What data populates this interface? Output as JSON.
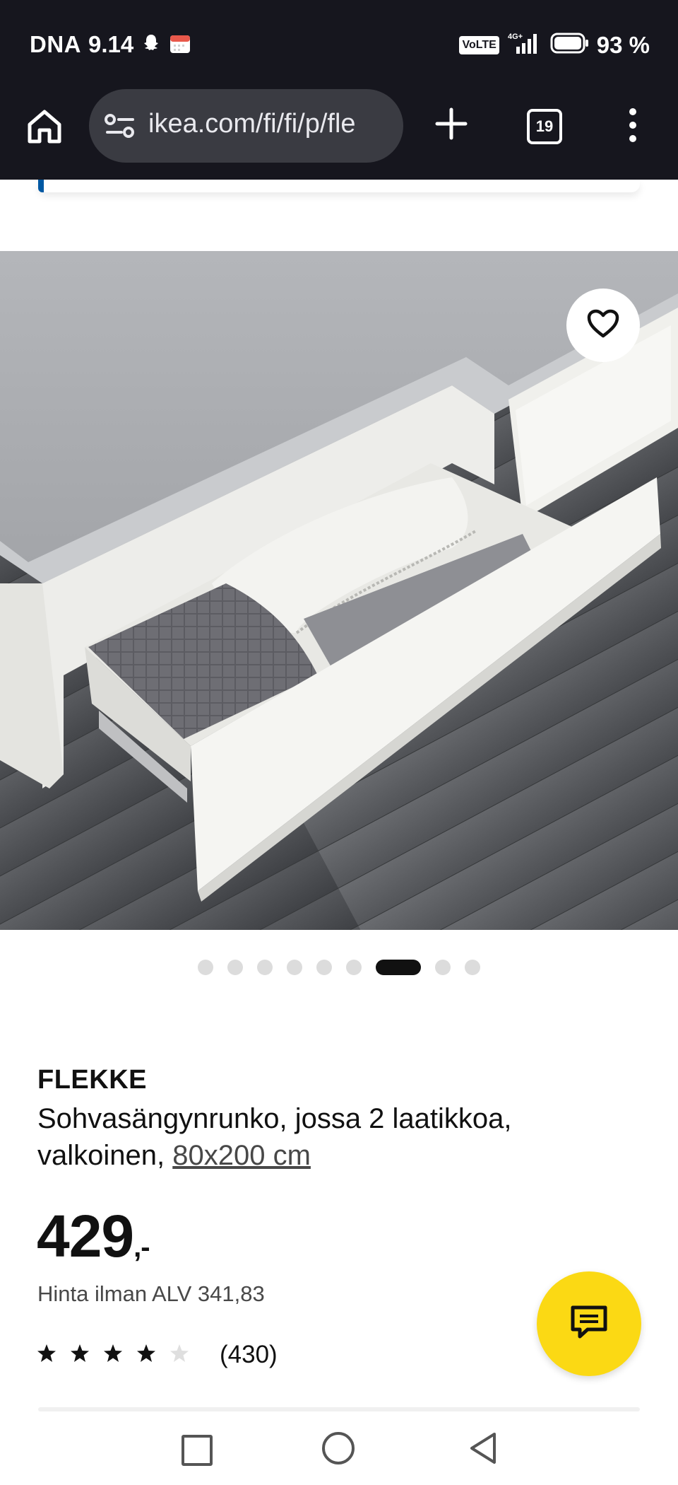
{
  "status_bar": {
    "carrier": "DNA",
    "time": "9.14",
    "network_badge": "VoLTE",
    "network_type": "4G+",
    "battery": "93 %",
    "icons": [
      "snapchat-icon",
      "calendar-icon",
      "signal-icon",
      "battery-icon"
    ]
  },
  "browser": {
    "url": "ikea.com/fi/fi/p/fle",
    "tab_count": "19",
    "icons": [
      "home-icon",
      "site-settings-icon",
      "plus-icon",
      "tabs-icon",
      "more-menu-icon"
    ]
  },
  "gallery": {
    "image_alt": "FLEKKE bed frame with open drawer",
    "dot_count": 9,
    "active_dot_index": 6,
    "favorite_icon": "heart-icon"
  },
  "product": {
    "name": "FLEKKE",
    "description": "Sohvasängynrunko, jossa 2 laatikkoa, valkoinen,",
    "size_link": "80x200 cm",
    "price": "429",
    "price_suffix": ",-",
    "price_without_vat": "Hinta ilman ALV 341,83",
    "rating_value": 4,
    "rating_max": 5,
    "review_count": "(430)"
  },
  "chat": {
    "icon": "chat-icon"
  },
  "nav": {
    "icons": [
      "recents-icon",
      "home-circle-icon",
      "back-icon"
    ]
  },
  "colors": {
    "status_bg": "#16161e",
    "url_bg": "#3a3b42",
    "chat_yellow": "#fbd914",
    "ikea_blue": "#0058a3",
    "text": "#111111"
  }
}
